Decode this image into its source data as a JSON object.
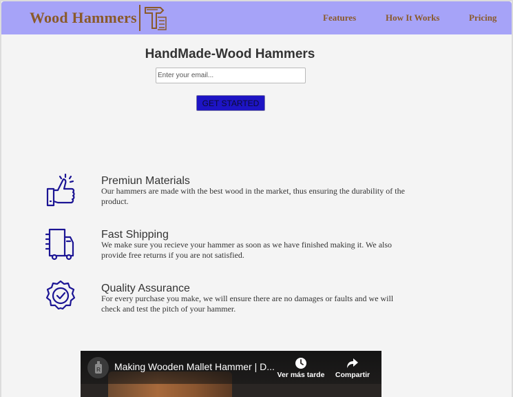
{
  "header": {
    "logo_text": "Wood Hammers",
    "nav": [
      "Features",
      "How It Works",
      "Pricing"
    ]
  },
  "hero": {
    "title": "HandMade-Wood Hammers",
    "email_placeholder": "Enter your email...",
    "cta_label": "GET STARTED"
  },
  "features": [
    {
      "icon": "thumbs-up-icon",
      "title": "Premiun Materials",
      "description": "Our hammers are made with the best wood in the market, thus ensuring the durability of the product."
    },
    {
      "icon": "delivery-truck-icon",
      "title": "Fast Shipping",
      "description": "We make sure you recieve your hammer as soon as we have finished making it. We also provide free returns if you are not satisfied."
    },
    {
      "icon": "quality-badge-icon",
      "title": "Quality Assurance",
      "description": "For every purchase you make, we will ensure there are no damages or faults and we will check and test the pitch of your hammer."
    }
  ],
  "video": {
    "title": "Making Wooden Mallet Hammer | D...",
    "watch_later_label": "Ver más tarde",
    "share_label": "Compartir"
  },
  "colors": {
    "header_bg": "#a6a3f8",
    "brand_brown": "#8a5a2a",
    "icon_navy": "#1b1494",
    "button_bg": "#1d14c4",
    "page_bg": "#f4f4f4"
  }
}
